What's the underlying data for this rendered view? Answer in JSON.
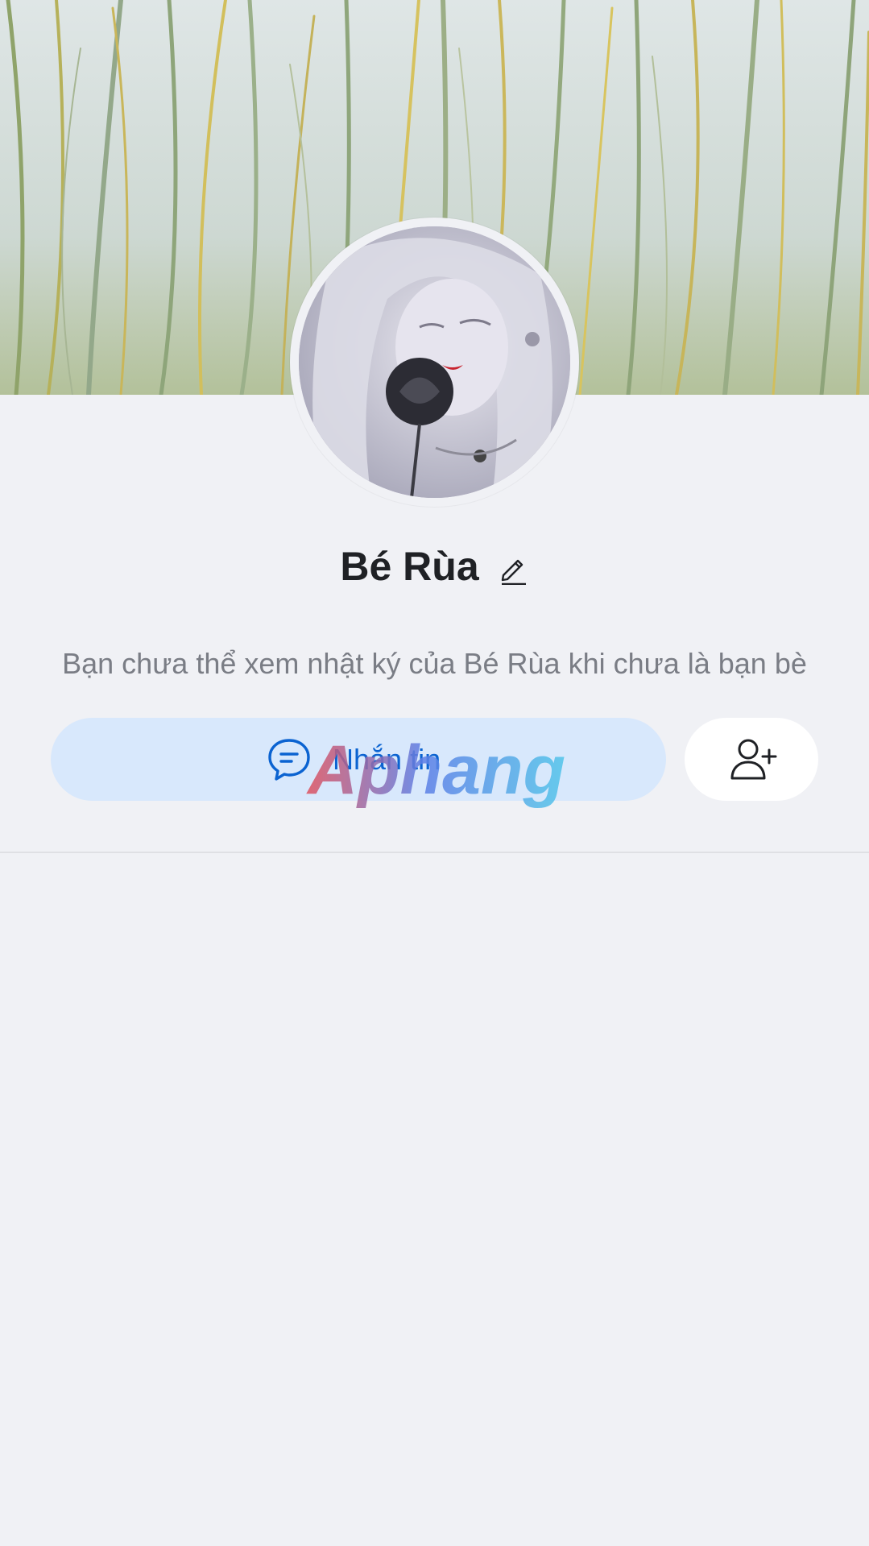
{
  "profile": {
    "name": "Bé Rùa",
    "privacy_notice": "Bạn chưa thể xem nhật ký của Bé Rùa khi chưa là bạn bè"
  },
  "actions": {
    "message_label": "Nhắn tin",
    "message_icon": "chat-bubble-icon",
    "add_friend_icon": "add-user-icon"
  },
  "header": {
    "edit_icon": "pencil-icon"
  },
  "watermark": {
    "text": "Aphang"
  },
  "colors": {
    "background": "#f0f1f5",
    "message_button_bg": "#d8e8fc",
    "message_button_text": "#0b63d1",
    "name_text": "#1f2125",
    "notice_text": "#7a7d85"
  }
}
